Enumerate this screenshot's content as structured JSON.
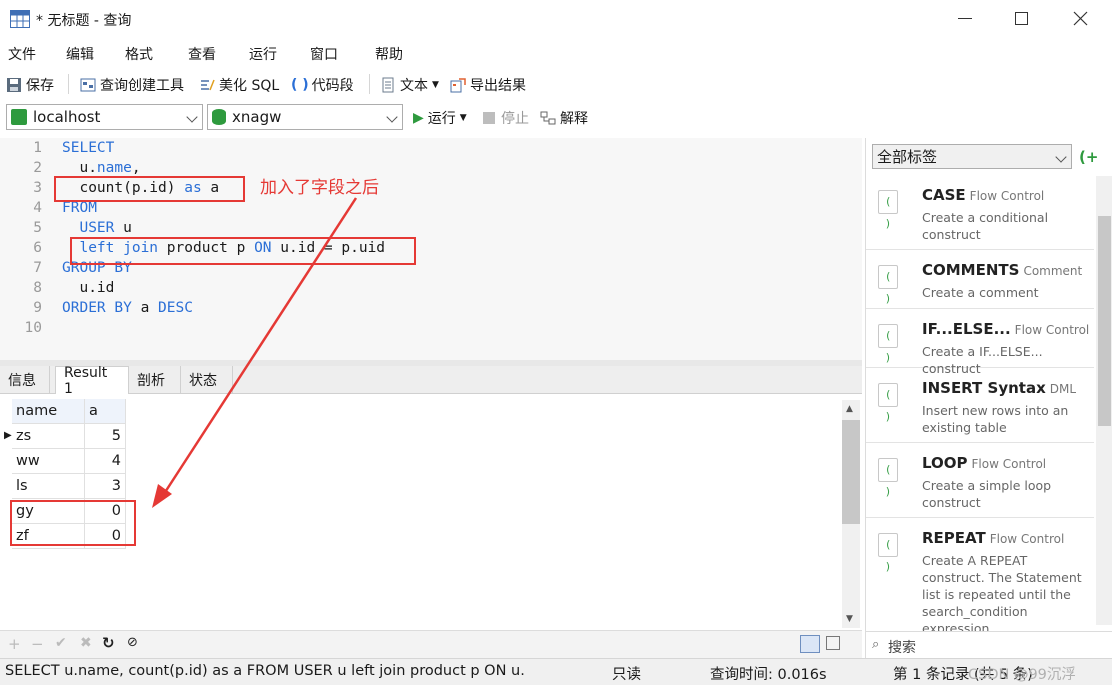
{
  "window": {
    "title": "* 无标题 - 查询"
  },
  "menu": [
    "文件",
    "编辑",
    "格式",
    "查看",
    "运行",
    "窗口",
    "帮助"
  ],
  "toolbar1": {
    "save": "保存",
    "query_builder": "查询创建工具",
    "beautify": "美化 SQL",
    "snippet": "代码段",
    "text": "文本",
    "export": "导出结果"
  },
  "toolbar2": {
    "connection": "localhost",
    "database": "xnagw",
    "run": "运行",
    "stop": "停止",
    "explain": "解释"
  },
  "editor": {
    "line_numbers": [
      "1",
      "2",
      "3",
      "4",
      "5",
      "6",
      "7",
      "8",
      "9",
      "10"
    ]
  },
  "annotation": {
    "note": "加入了字段之后"
  },
  "result_tabs": [
    "信息",
    "Result 1",
    "剖析",
    "状态"
  ],
  "grid": {
    "columns": [
      "name",
      "a"
    ],
    "rows": [
      {
        "name": "zs",
        "a": "5"
      },
      {
        "name": "ww",
        "a": "4"
      },
      {
        "name": "ls",
        "a": "3"
      },
      {
        "name": "gy",
        "a": "0"
      },
      {
        "name": "zf",
        "a": "0"
      }
    ]
  },
  "right_panel": {
    "filter": "全部标签",
    "search_placeholder": "搜索",
    "snippets": [
      {
        "title": "CASE",
        "category": "Flow Control",
        "desc": "Create a conditional construct"
      },
      {
        "title": "COMMENTS",
        "category": "Comment",
        "desc": "Create a comment"
      },
      {
        "title": "IF...ELSE...",
        "category": "Flow Control",
        "desc": "Create a IF...ELSE... construct"
      },
      {
        "title": "INSERT Syntax",
        "category": "DML",
        "desc": "Insert new rows into an existing table"
      },
      {
        "title": "LOOP",
        "category": "Flow Control",
        "desc": "Create a simple loop construct"
      },
      {
        "title": "REPEAT",
        "category": "Flow Control",
        "desc": "Create A REPEAT construct. The Statement list is repeated until the search_condition expression"
      }
    ]
  },
  "status": {
    "sql": "SELECT     u.name,    count(p.id) as a FROM        USER u    left join product p ON u.",
    "readonly": "只读",
    "query_time": "查询时间: 0.016s",
    "records": "第 1 条记录 (共 5 条)",
    "watermark": "CSDN @99沉浮"
  }
}
